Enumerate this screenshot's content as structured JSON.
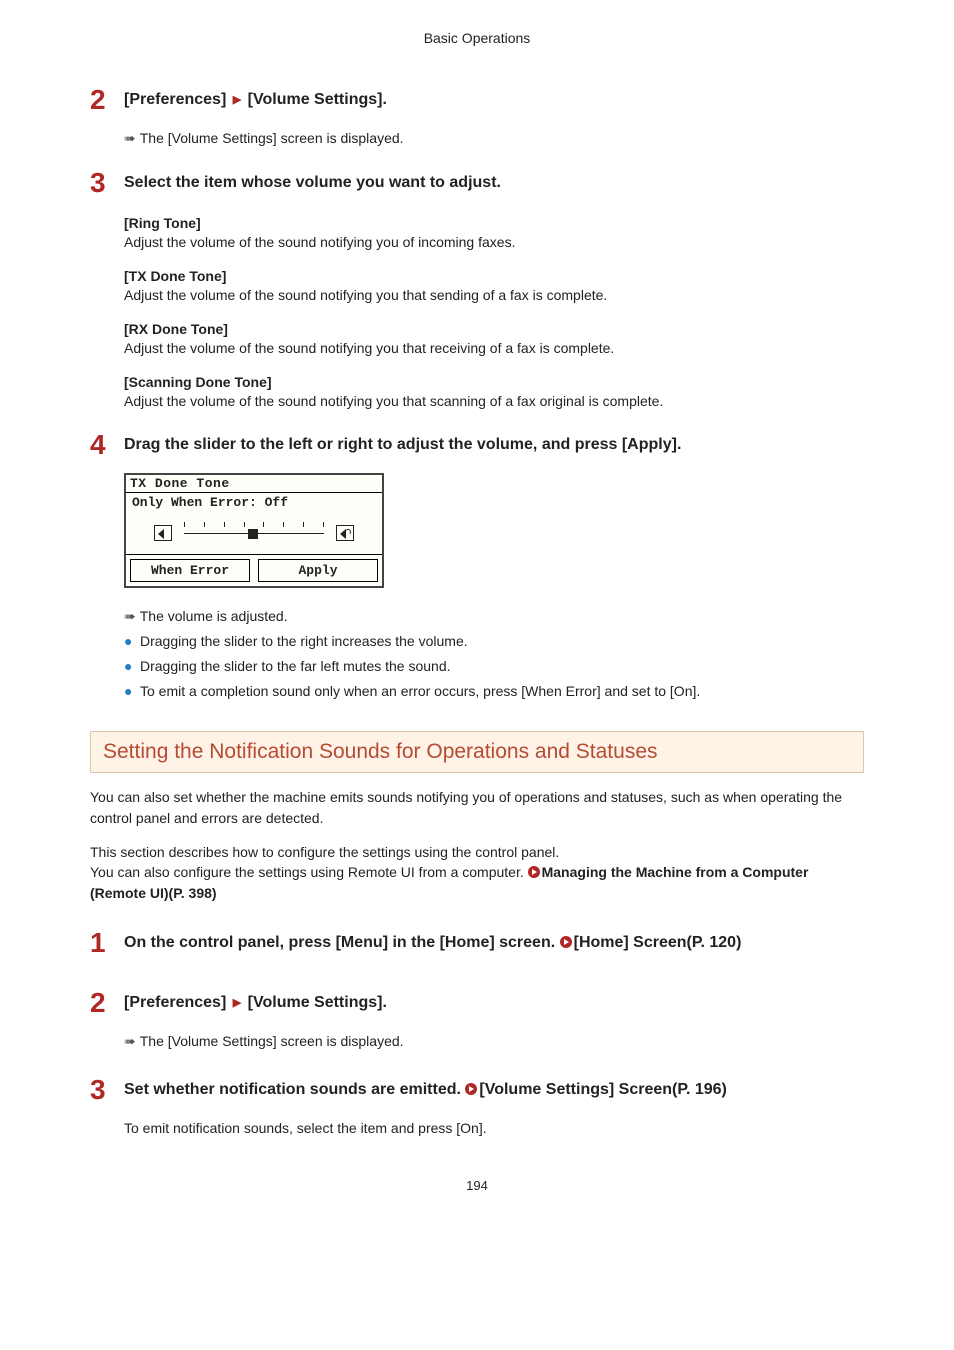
{
  "header": {
    "title": "Basic Operations"
  },
  "step2": {
    "num": "2",
    "path_a": "[Preferences]",
    "path_b": "[Volume Settings].",
    "result": "The [Volume Settings] screen is displayed."
  },
  "step3": {
    "num": "3",
    "heading": "Select the item whose volume you want to adjust.",
    "items": [
      {
        "title": "[Ring Tone]",
        "desc": "Adjust the volume of the sound notifying you of incoming faxes."
      },
      {
        "title": "[TX Done Tone]",
        "desc": "Adjust the volume of the sound notifying you that sending of a fax is complete."
      },
      {
        "title": "[RX Done Tone]",
        "desc": "Adjust the volume of the sound notifying you that receiving of a fax is complete."
      },
      {
        "title": "[Scanning Done Tone]",
        "desc": "Adjust the volume of the sound notifying you that scanning of a fax original is complete."
      }
    ]
  },
  "step4": {
    "num": "4",
    "heading": "Drag the slider to the left or right to adjust the volume, and press [Apply].",
    "lcd": {
      "title": "TX Done Tone",
      "sub": "Only When Error: Off",
      "btn_left": "When Error",
      "btn_right": "Apply"
    },
    "result": "The volume is adjusted.",
    "bullets": [
      "Dragging the slider to the right increases the volume.",
      "Dragging the slider to the far left mutes the sound.",
      "To emit a completion sound only when an error occurs, press [When Error] and set to [On]."
    ]
  },
  "section2": {
    "heading": "Setting the Notification Sounds for Operations and Statuses",
    "p1": "You can also set whether the machine emits sounds notifying you of operations and statuses, such as when operating the control panel and errors are detected.",
    "p2a": "This section describes how to configure the settings using the control panel.",
    "p2b": "You can also configure the settings using Remote UI from a computer. ",
    "link1": "Managing the Machine from a Computer (Remote UI)(P. 398)"
  },
  "step_s2_1": {
    "num": "1",
    "heading_a": "On the control panel, press [Menu] in the [Home] screen. ",
    "link": "[Home] Screen(P. 120)"
  },
  "step_s2_2": {
    "num": "2",
    "path_a": "[Preferences]",
    "path_b": "[Volume Settings].",
    "result": "The [Volume Settings] screen is displayed."
  },
  "step_s2_3": {
    "num": "3",
    "heading_a": "Set whether notification sounds are emitted. ",
    "link": "[Volume Settings] Screen(P. 196)",
    "body": "To emit notification sounds, select the item and press [On]."
  },
  "page_number": "194"
}
